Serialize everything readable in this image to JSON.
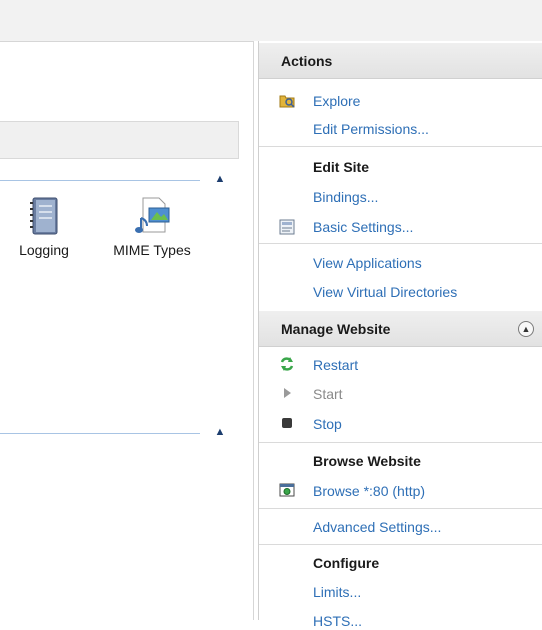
{
  "features": {
    "logging_label": "Logging",
    "mime_label": "MIME Types"
  },
  "actions": {
    "header": "Actions",
    "explore": "Explore",
    "edit_permissions": "Edit Permissions...",
    "edit_site_title": "Edit Site",
    "bindings": "Bindings...",
    "basic_settings": "Basic Settings...",
    "view_applications": "View Applications",
    "view_virtual_directories": "View Virtual Directories",
    "manage_header": "Manage Website",
    "restart": "Restart",
    "start": "Start",
    "stop": "Stop",
    "browse_title": "Browse Website",
    "browse": "Browse *:80 (http)",
    "advanced_settings": "Advanced Settings...",
    "configure_title": "Configure",
    "limits": "Limits...",
    "hsts": "HSTS..."
  },
  "colors": {
    "link": "#2e6fb6",
    "disabled": "#8a8a8a",
    "restart_green": "#3aa64a"
  }
}
